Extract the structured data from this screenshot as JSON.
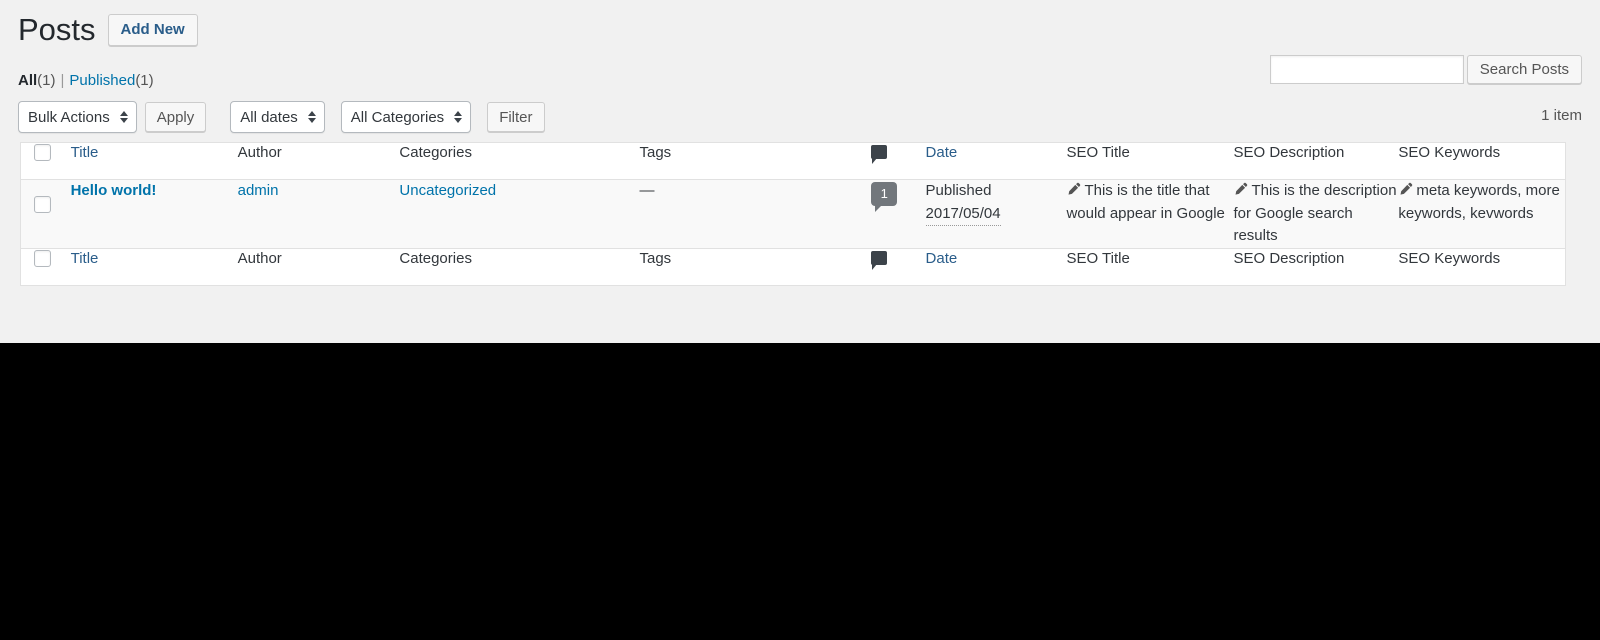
{
  "header": {
    "title": "Posts",
    "add_new_label": "Add New"
  },
  "views": {
    "all_label": "All",
    "all_count": "(1)",
    "separator": "|",
    "published_label": "Published",
    "published_count": "(1)"
  },
  "search": {
    "value": "",
    "placeholder": "",
    "submit_label": "Search Posts"
  },
  "tablenav": {
    "bulk_actions_selected": "Bulk Actions",
    "apply_label": "Apply",
    "dates_selected": "All dates",
    "categories_selected": "All Categories",
    "filter_label": "Filter",
    "displaying_num": "1 item"
  },
  "table": {
    "columns": {
      "title": "Title",
      "author": "Author",
      "categories": "Categories",
      "tags": "Tags",
      "comments_icon": "comment-bubble-icon",
      "date": "Date",
      "seo_title": "SEO Title",
      "seo_description": "SEO Description",
      "seo_keywords": "SEO Keywords"
    },
    "rows": [
      {
        "title": "Hello world!",
        "author": "admin",
        "categories": "Uncategorized",
        "tags": "—",
        "comment_count": "1",
        "date_status": "Published",
        "date_value": "2017/05/04",
        "seo_title": "This is the title that would appear in Google",
        "seo_description": "This is the description for Google search results",
        "seo_keywords": "meta keywords, more keywords, kevwords"
      }
    ]
  },
  "colors": {
    "link": "#0073aa",
    "sortable_link": "#2a5d8a",
    "page_bg": "#f1f1f1",
    "row_bg": "#f9f9f9",
    "comment_bubble": "#72777c"
  }
}
